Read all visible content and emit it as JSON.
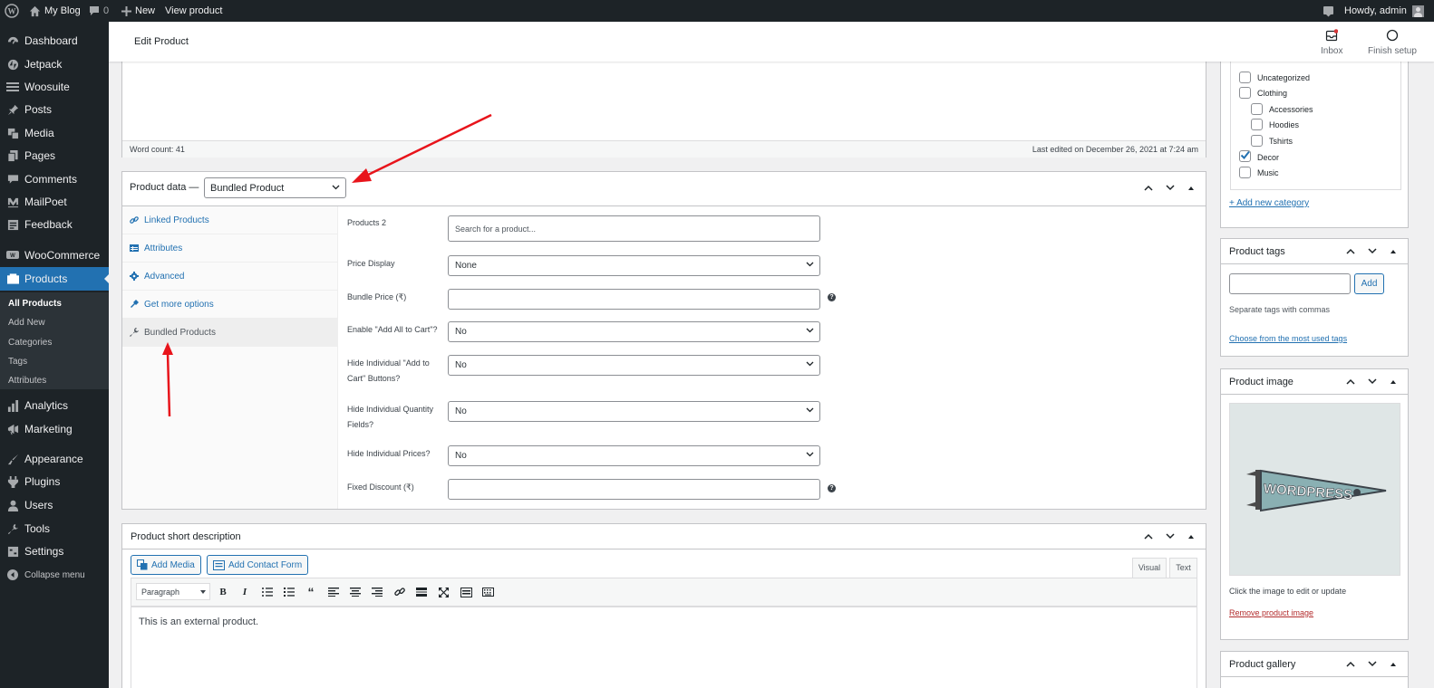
{
  "admin_bar": {
    "site_name": "My Blog",
    "comments_count": "0",
    "new_label": "New",
    "view_product_label": "View product",
    "howdy": "Howdy, admin"
  },
  "sidebar": {
    "items": [
      {
        "label": "Dashboard",
        "icon": "dashboard-icon"
      },
      {
        "label": "Jetpack",
        "icon": "jetpack-icon"
      },
      {
        "label": "Woosuite",
        "icon": "woosuite-icon"
      },
      {
        "label": "Posts",
        "icon": "pin-icon"
      },
      {
        "label": "Media",
        "icon": "media-icon"
      },
      {
        "label": "Pages",
        "icon": "pages-icon"
      },
      {
        "label": "Comments",
        "icon": "comments-icon"
      },
      {
        "label": "MailPoet",
        "icon": "mailpoet-icon"
      },
      {
        "label": "Feedback",
        "icon": "feedback-icon"
      },
      {
        "label": "WooCommerce",
        "icon": "woocommerce-icon"
      },
      {
        "label": "Products",
        "icon": "products-icon"
      },
      {
        "label": "Analytics",
        "icon": "analytics-icon"
      },
      {
        "label": "Marketing",
        "icon": "marketing-icon"
      },
      {
        "label": "Appearance",
        "icon": "appearance-icon"
      },
      {
        "label": "Plugins",
        "icon": "plugins-icon"
      },
      {
        "label": "Users",
        "icon": "users-icon"
      },
      {
        "label": "Tools",
        "icon": "tools-icon"
      },
      {
        "label": "Settings",
        "icon": "settings-icon"
      },
      {
        "label": "Collapse menu",
        "icon": "collapse-icon"
      }
    ],
    "submenu": [
      "All Products",
      "Add New",
      "Categories",
      "Tags",
      "Attributes"
    ]
  },
  "header": {
    "title": "Edit Product",
    "inbox_label": "Inbox",
    "finish_setup_label": "Finish setup"
  },
  "editor": {
    "word_count": "Word count: 41",
    "last_edited": "Last edited on December 26, 2021 at 7:24 am"
  },
  "product_data": {
    "title": "Product data —",
    "type_selected": "Bundled Product",
    "tabs": [
      {
        "label": "Linked Products",
        "icon": "link-icon"
      },
      {
        "label": "Attributes",
        "icon": "table-icon"
      },
      {
        "label": "Advanced",
        "icon": "gear-icon"
      },
      {
        "label": "Get more options",
        "icon": "plugin-icon"
      },
      {
        "label": "Bundled Products",
        "icon": "wrench-icon"
      }
    ],
    "fields": {
      "products_label": "Products 2",
      "products_placeholder": "Search for a product...",
      "price_display_label": "Price Display",
      "price_display_value": "None",
      "bundle_price_label": "Bundle Price (₹)",
      "enable_add_all_label": "Enable \"Add All to Cart\"?",
      "enable_add_all_value": "No",
      "hide_add_to_cart_label_1": "Hide Individual \"Add to",
      "hide_add_to_cart_label_2": "Cart\" Buttons?",
      "hide_add_to_cart_value": "No",
      "hide_qty_label_1": "Hide Individual Quantity",
      "hide_qty_label_2": "Fields?",
      "hide_qty_value": "No",
      "hide_prices_label": "Hide Individual Prices?",
      "hide_prices_value": "No",
      "fixed_discount_label": "Fixed Discount (₹)"
    }
  },
  "short_description": {
    "title": "Product short description",
    "add_media": "Add Media",
    "add_contact_form": "Add Contact Form",
    "visual_tab": "Visual",
    "text_tab": "Text",
    "format_select": "Paragraph",
    "content": "This is an external product."
  },
  "categories": {
    "items": [
      {
        "label": "Uncategorized",
        "checked": false
      },
      {
        "label": "Clothing",
        "checked": false
      },
      {
        "label": "Accessories",
        "checked": false
      },
      {
        "label": "Hoodies",
        "checked": false
      },
      {
        "label": "Tshirts",
        "checked": false
      },
      {
        "label": "Decor",
        "checked": true
      },
      {
        "label": "Music",
        "checked": false
      }
    ],
    "add_new": "+ Add new category"
  },
  "tags": {
    "title": "Product tags",
    "add_button": "Add",
    "help": "Separate tags with commas",
    "choose_link": "Choose from the most used tags"
  },
  "product_image": {
    "title": "Product image",
    "help": "Click the image to edit or update",
    "remove_link": "Remove product image",
    "pennant_text": "WORDPRESS"
  },
  "gallery": {
    "title": "Product gallery"
  },
  "colors": {
    "admin_dark": "#1d2327",
    "accent": "#2271b1",
    "annotation_arrow": "#e8141b",
    "remove_link": "#b32d2e"
  }
}
